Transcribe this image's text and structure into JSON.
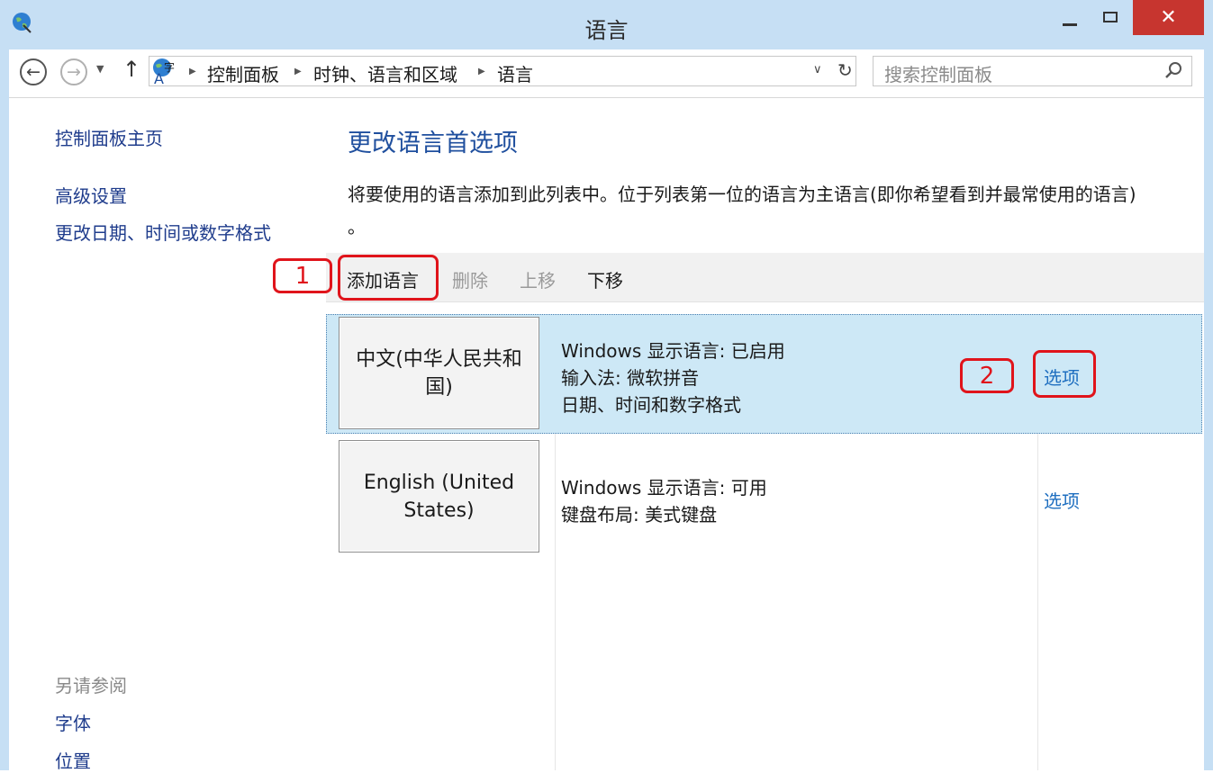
{
  "window": {
    "title": "语言",
    "close_glyph": "✕"
  },
  "nav": {
    "back_icon": "back-arrow-icon",
    "forward_icon": "forward-arrow-icon",
    "breadcrumbs": [
      "控制面板",
      "时钟、语言和区域",
      "语言"
    ],
    "search_placeholder": "搜索控制面板"
  },
  "sidebar": {
    "home": "控制面板主页",
    "items": [
      "高级设置",
      "更改日期、时间或数字格式"
    ],
    "see_also_label": "另请参阅",
    "see_also_items": [
      "字体",
      "位置"
    ]
  },
  "main": {
    "heading": "更改语言首选项",
    "description_line1": "将要使用的语言添加到此列表中。位于列表第一位的语言为主语言(即你希望看到并最常使用的语言)",
    "description_line2": "。",
    "toolbar": {
      "add": "添加语言",
      "remove": "删除",
      "move_up": "上移",
      "move_down": "下移"
    },
    "languages": [
      {
        "name": "中文(中华人民共和国)",
        "details": [
          "Windows 显示语言: 已启用",
          "输入法: 微软拼音",
          "日期、时间和数字格式"
        ],
        "options": "选项"
      },
      {
        "name": "English (United States)",
        "details": [
          "Windows 显示语言: 可用",
          "键盘布局: 美式键盘"
        ],
        "options": "选项"
      }
    ]
  },
  "annotations": [
    "1",
    "2"
  ],
  "colors": {
    "titlebar": "#c6dff4",
    "close": "#c7352f",
    "selected_row": "#cde8f6",
    "link": "#1f3c8c",
    "annotation": "#e0141b"
  }
}
